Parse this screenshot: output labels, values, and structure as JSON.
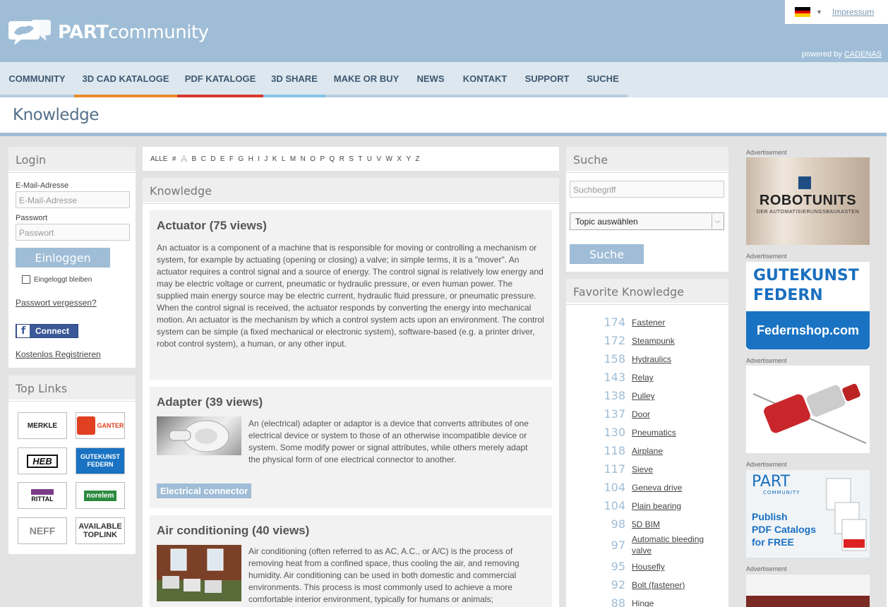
{
  "header": {
    "logo_bold": "PART",
    "logo_light": "community",
    "impressum": "Impressum",
    "powered_by": "powered by",
    "powered_link": "CADENAS",
    "language": "German"
  },
  "nav": [
    {
      "label": "COMMUNITY",
      "color": "#b7cde0"
    },
    {
      "label": "3D CAD KATALOGE",
      "color": "#e88b2e"
    },
    {
      "label": "PDF KATALOGE",
      "color": "#d9382e"
    },
    {
      "label": "3D SHARE",
      "color": "#88c3e6"
    },
    {
      "label": "MAKE OR BUY",
      "color": "#b7cde0"
    },
    {
      "label": "NEWS",
      "color": "#b7cde0"
    },
    {
      "label": "KONTAKT",
      "color": "#b7cde0"
    },
    {
      "label": "SUPPORT",
      "color": "#b7cde0"
    },
    {
      "label": "SUCHE",
      "color": "#b7cde0"
    }
  ],
  "page_title": "Knowledge",
  "login": {
    "title": "Login",
    "email_label": "E-Mail-Adresse",
    "email_placeholder": "E-Mail-Adresse",
    "password_label": "Passwort",
    "password_placeholder": "Passwort",
    "login_button": "Einloggen",
    "remember": "Eingeloggt bleiben",
    "forgot": "Passwort vergessen?",
    "facebook_connect": "Connect",
    "register": "Kostenlos Registrieren"
  },
  "toplinks": {
    "title": "Top Links",
    "items": [
      "MERKLE",
      "GANTER",
      "HEB",
      "GUTEKUNST FEDERN",
      "RITTAL",
      "norelem",
      "NEFF",
      "AVAILABLE TOPLINK"
    ]
  },
  "alphabet": [
    "ALLE",
    "#",
    "A",
    "B",
    "C",
    "D",
    "E",
    "F",
    "G",
    "H",
    "I",
    "J",
    "K",
    "L",
    "M",
    "N",
    "O",
    "P",
    "Q",
    "R",
    "S",
    "T",
    "U",
    "V",
    "W",
    "X",
    "Y",
    "Z"
  ],
  "knowledge": {
    "title": "Knowledge",
    "articles": [
      {
        "title": "Actuator (75 views)",
        "text": "An actuator is a component of a machine that is responsible for moving or controlling a mechanism or system, for example by actuating (opening or closing) a valve; in simple terms, it is a \"mover\". An actuator requires a control signal and a source of energy. The control signal is relatively low energy and may be electric voltage or current, pneumatic or hydraulic pressure, or even human power. The supplied main energy source may be electric current, hydraulic fluid pressure, or pneumatic pressure. When the control signal is received, the actuator responds by converting the energy into mechanical motion. An actuator is the mechanism by which a control system acts upon an environment. The control system can be simple (a fixed mechanical or electronic system), software-based (e.g. a printer driver, robot control system), a human, or any other input."
      },
      {
        "title": "Adapter (39 views)",
        "text": "An (electrical) adapter or adaptor is a device that converts attributes of one electrical device or system to those of an otherwise incompatible device or system. Some modify power or signal attributes, while others merely adapt the physical form of one electrical connector to another.",
        "tag": "Electrical connector"
      },
      {
        "title": "Air conditioning (40 views)",
        "text": "Air conditioning (often referred to as AC, A.C., or A/C) is the process of removing heat from a confined space, thus cooling the air, and removing humidity. Air conditioning can be used in both domestic and commercial environments. This process is most commonly used to achieve a more comfortable interior environment, typically for humans or animals;"
      }
    ]
  },
  "search": {
    "title": "Suche",
    "placeholder": "Suchbegriff",
    "topic_select": "Topic auswählen",
    "button": "Suche"
  },
  "favorites": {
    "title": "Favorite Knowledge",
    "items": [
      {
        "count": "174",
        "label": "Fastener"
      },
      {
        "count": "172",
        "label": "Steampunk"
      },
      {
        "count": "158",
        "label": "Hydraulics"
      },
      {
        "count": "143",
        "label": "Relay"
      },
      {
        "count": "138",
        "label": "Pulley"
      },
      {
        "count": "137",
        "label": "Door"
      },
      {
        "count": "130",
        "label": "Pneumatics"
      },
      {
        "count": "118",
        "label": "Airplane"
      },
      {
        "count": "117",
        "label": "Sieve"
      },
      {
        "count": "104",
        "label": "Geneva drive"
      },
      {
        "count": "104",
        "label": "Plain bearing"
      },
      {
        "count": "98",
        "label": "5D BIM"
      },
      {
        "count": "97",
        "label": "Automatic bleeding valve"
      },
      {
        "count": "95",
        "label": "Housefly"
      },
      {
        "count": "92",
        "label": "Bolt (fastener)"
      },
      {
        "count": "88",
        "label": "Hinge"
      }
    ]
  },
  "ads": {
    "label": "Advertisement",
    "robotunits_name": "ROBOTUNITS",
    "robotunits_tagline": "DER AUTOMATISIERUNGSBAUKASTEN",
    "gutekunst_line1": "GUTEKUNST",
    "gutekunst_line2": "FEDERN",
    "gutekunst_shop": "Federnshop.com",
    "partcommunity_logo": "PART",
    "partcommunity_sub": "COMMUNITY",
    "partcommunity_text": [
      "Publish",
      "PDF Catalogs",
      "for FREE"
    ]
  },
  "colors": {
    "header_bg": "#9fbdd6",
    "nav_bg": "#dde7ef",
    "accent": "#9fbdd6",
    "main_bg": "#e3e3e3"
  }
}
